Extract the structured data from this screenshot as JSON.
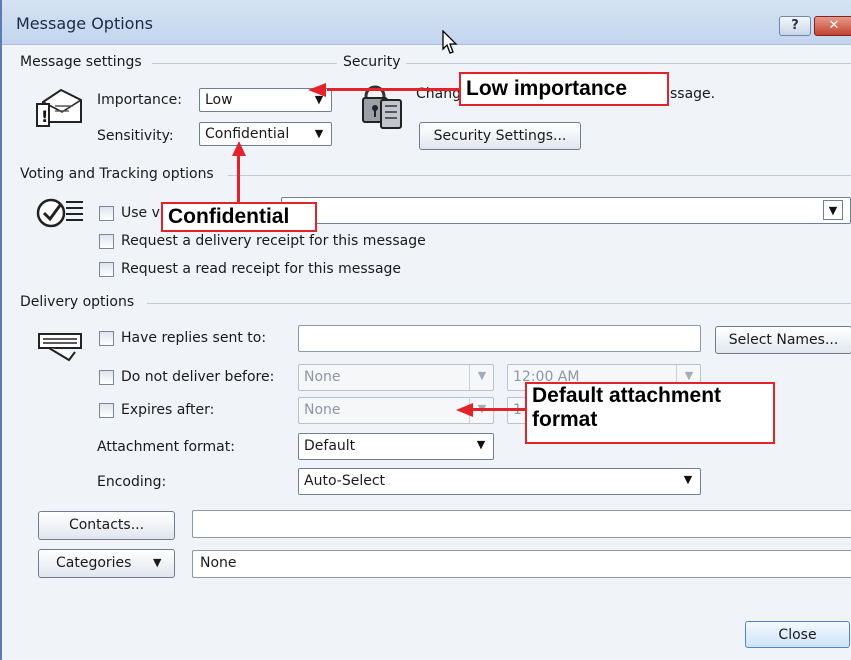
{
  "window": {
    "title": "Message Options",
    "help_label": "?",
    "close_label": "✕"
  },
  "message_settings": {
    "group_label": "Message settings",
    "importance_label": "Importance:",
    "importance_value": "Low",
    "sensitivity_label": "Sensitivity:",
    "sensitivity_value": "Confidential"
  },
  "security": {
    "group_label": "Security",
    "text_left": "Chang",
    "text_right": "ssage.",
    "settings_button": "Security Settings..."
  },
  "voting": {
    "group_label": "Voting and Tracking options",
    "use_voting_label": "Use v",
    "delivery_receipt_label": "Request a delivery receipt for this message",
    "read_receipt_label": "Request a read receipt for this message"
  },
  "delivery": {
    "group_label": "Delivery options",
    "replies_label": "Have replies sent to:",
    "select_names_button": "Select Names...",
    "do_not_deliver_label": "Do not deliver before:",
    "do_not_deliver_date": "None",
    "do_not_deliver_time": "12:00 AM",
    "expires_label": "Expires after:",
    "expires_date": "None",
    "expires_time_partial": "1",
    "attachment_format_label": "Attachment format:",
    "attachment_format_value": "Default",
    "encoding_label": "Encoding:",
    "encoding_value": "Auto-Select"
  },
  "footer": {
    "contacts_button": "Contacts...",
    "categories_button": "Categories",
    "categories_value": "None",
    "close_button": "Close"
  },
  "callouts": {
    "low_importance": "Low importance",
    "confidential": "Confidential",
    "default_attachment_line1": "Default attachment",
    "default_attachment_line2": "format"
  },
  "colors": {
    "callout_accent": "#e2232a",
    "title_bar": "#c3d5ee"
  }
}
